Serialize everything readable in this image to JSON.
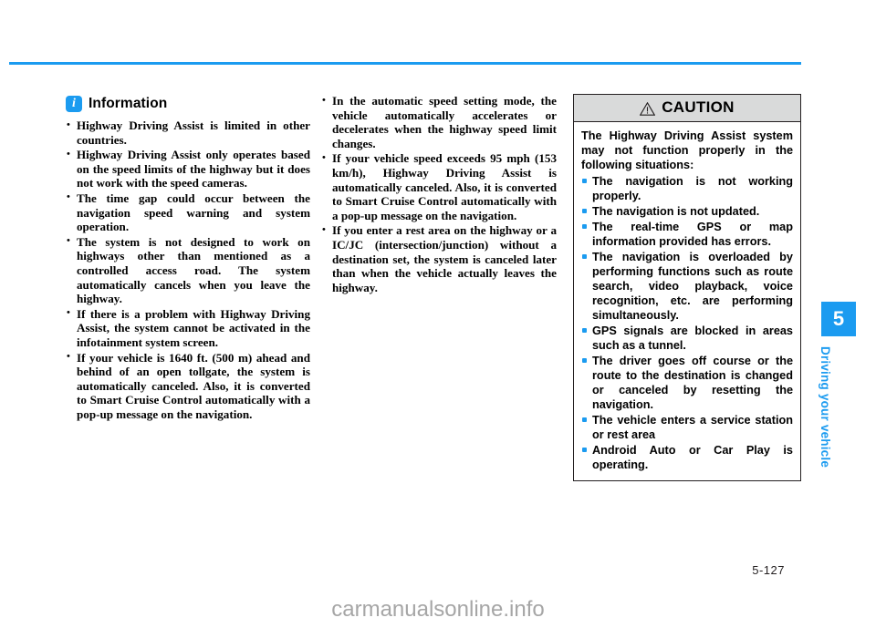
{
  "page": {
    "number": "5-127",
    "watermark": "carmanualsonline.info",
    "accent_color": "#1b9bf0",
    "rule_color": "#1b9bf0"
  },
  "chapter_tab": {
    "number": "5",
    "label": "Driving your vehicle"
  },
  "information": {
    "icon": "info-icon",
    "title": "Information",
    "items": [
      "Highway Driving Assist is limited in other countries.",
      "Highway Driving Assist only operates based on the speed limits of the highway but it does not work with the speed cameras.",
      "The time gap could occur between the navigation speed warning and system operation.",
      "The system is not designed to work on highways other than mentioned as a controlled access road. The system automatically cancels when you leave the highway.",
      "If there is a problem with Highway Driving Assist, the system cannot be activated in the infotainment system screen.",
      "If your vehicle is 1640 ft. (500 m) ahead and behind of an open tollgate, the system is automatically canceled. Also, it is converted to Smart Cruise Control automatically with a pop-up message on the navigation."
    ]
  },
  "information_continued": {
    "items": [
      "In the automatic speed setting mode, the vehicle automatically accelerates or decelerates when the highway speed limit changes.",
      "If your vehicle speed exceeds 95 mph (153 km/h), Highway Driving Assist is automatically canceled. Also, it is converted to Smart Cruise Control automatically with a pop-up message on the navigation.",
      "If you enter a rest area on the highway or a IC/JC (intersection/junction) without a destination set, the system is canceled later than when the vehicle actually leaves the highway."
    ]
  },
  "caution": {
    "icon": "warning-triangle-icon",
    "title": "CAUTION",
    "intro": "The Highway Driving Assist system may not function properly in the following situations:",
    "items": [
      "The navigation is not working properly.",
      "The navigation is not updated.",
      "The real-time GPS or map information provided has errors.",
      "The navigation is overloaded by performing functions such as route search, video playback, voice recognition, etc. are performing simultaneously.",
      "GPS signals are blocked in areas such as a tunnel.",
      "The driver goes off course or the route to the destination is changed or canceled by resetting the navigation.",
      "The vehicle enters a service station or rest area",
      "Android Auto or Car Play is operating."
    ]
  }
}
